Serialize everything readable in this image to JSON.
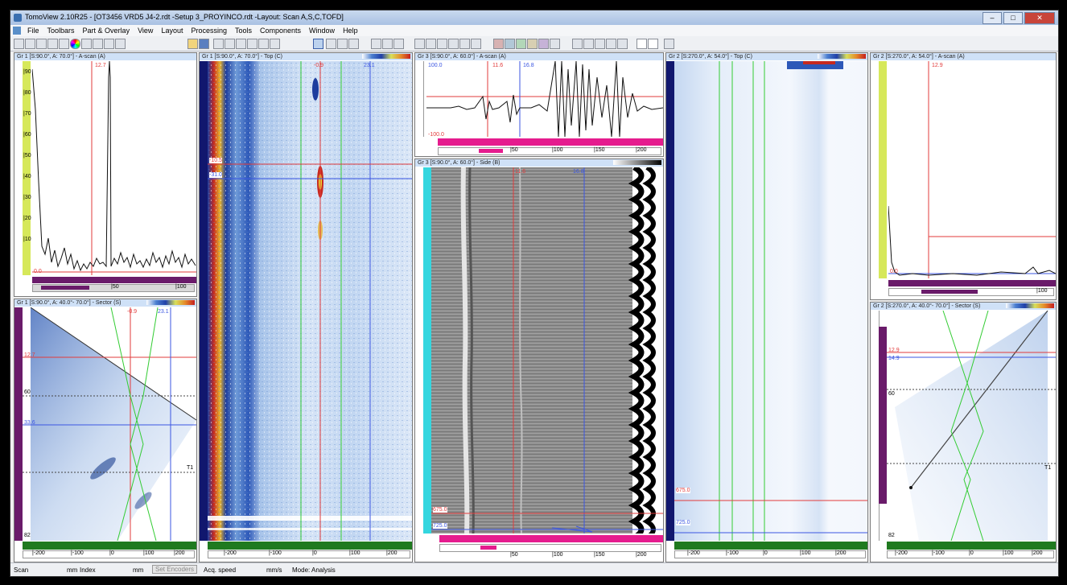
{
  "window": {
    "title": "TomoView 2.10R25 - [OT3456 VRD5 J4-2.rdt -Setup 3_PROYINCO.rdt -Layout: Scan A,S,C,TOFD]"
  },
  "menu": [
    "File",
    "Toolbars",
    "Part & Overlay",
    "View",
    "Layout",
    "Processing",
    "Tools",
    "Components",
    "Window",
    "Help"
  ],
  "panels": {
    "p1": {
      "title": "Gr 1 [S:90.0°, A: 70.0°] - A-scan (A)",
      "cursor": "12.7",
      "base": "0.0",
      "scale": [
        "|50",
        "|100"
      ],
      "yticks": [
        "|90",
        "|80",
        "|70",
        "|60",
        "|50",
        "|40",
        "|30",
        "|20",
        "|10"
      ]
    },
    "p2": {
      "title": "Gr 1 [S:90.0°, A: 40.0°- 70.0°] - Sector (S)",
      "top_left": "-0.9",
      "top_right": "23.1",
      "r1": "12.7",
      "r2": "60",
      "r3": "33.6",
      "r4": "T1",
      "bottom": "82",
      "scale": [
        "|-200",
        "|-100",
        "|0",
        "|100",
        "|200"
      ]
    },
    "p3": {
      "title": "Gr 1 [S:90.0°, A: 70.0°] - Top (C)",
      "tl": "-0.9",
      "tr": "23.1",
      "c1": "-10.5",
      "c2": "-31.0",
      "scale": [
        "|-200",
        "|-100",
        "|0",
        "|100",
        "|200"
      ]
    },
    "p4": {
      "title": "Gr 3 [S:90.0°, A: 60.0°] - A-scan (A)",
      "c1": "11.6",
      "c2": "16.8",
      "top": "100.0",
      "bottom": "-100.0",
      "scale": [
        "|50",
        "|100",
        "|150",
        "|200"
      ]
    },
    "p5": {
      "title": "Gr 3 [S:90.0°, A: 60.0°] - Side (B)",
      "c1": "11.6",
      "c2": "16.8",
      "r1": "675.0",
      "r2": "725.0",
      "scale": [
        "|50",
        "|100",
        "|150",
        "|200"
      ]
    },
    "p6": {
      "title": "Gr 2 [S:270.0°, A: 54.0°] - Top (C)",
      "r1": "675.0",
      "r2": "725.0",
      "scale": [
        "|-200",
        "|-100",
        "|0",
        "|100",
        "|200"
      ]
    },
    "p7": {
      "title": "Gr 2 [S:270.0°, A: 54.0°] - A-scan (A)",
      "cursor": "12.9",
      "base": "0.0",
      "scale": [
        "|100"
      ]
    },
    "p8": {
      "title": "Gr 2 [S:270.0°, A: 40.0°- 70.0°] - Sector (S)",
      "r1": "12.9",
      "r2": "14.9",
      "r3": "60",
      "r4": "T1",
      "bottom": "82",
      "scale": [
        "|-200",
        "|-100",
        "|0",
        "|100",
        "|200"
      ]
    }
  },
  "status": {
    "scan": "Scan",
    "mm1": "mm",
    "index": "Index",
    "mm2": "mm",
    "set_encoders": "Set Encoders",
    "acq": "Acq. speed",
    "mms": "mm/s",
    "mode": "Mode: Analysis"
  },
  "colors": {
    "cursor_red": "#e23b3b",
    "cursor_blue": "#3b56e2",
    "cursor_green": "#33cc33",
    "ruler_purple": "#6a1b6a",
    "ruler_green": "#1f7a1f",
    "ruler_navy": "#11176e",
    "ruler_yellow": "#d6e85a",
    "ruler_magenta": "#e51c8e",
    "ruler_cyan": "#34d6df"
  }
}
